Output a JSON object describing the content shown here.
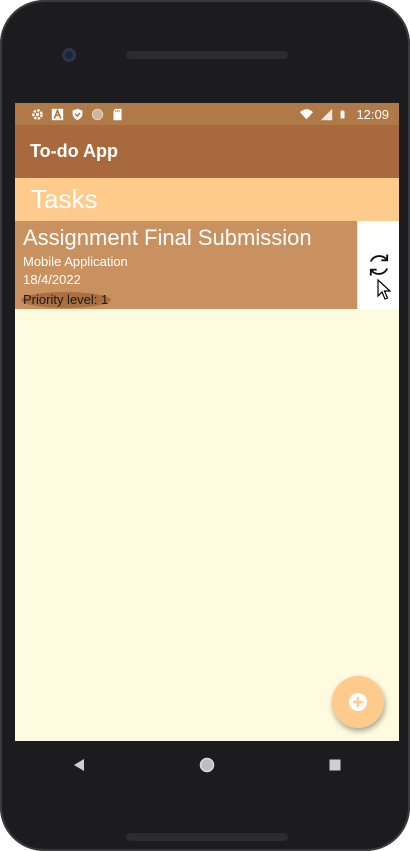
{
  "status_bar": {
    "time": "12:09",
    "left_icons": [
      "settings-icon",
      "a-icon",
      "shield-icon",
      "circle-icon",
      "sd-card-icon"
    ],
    "right_icons": [
      "wifi-icon",
      "signal-icon",
      "battery-icon"
    ]
  },
  "app_bar": {
    "title": "To-do App"
  },
  "tasks_header": {
    "title": "Tasks"
  },
  "tasks": [
    {
      "title": "Assignment Final Submission",
      "category": "Mobile Application",
      "date": "18/4/2022",
      "priority_label": "Priority level: 1",
      "action_icon": "refresh-icon"
    }
  ],
  "fab": {
    "icon": "add-circle-icon"
  },
  "nav_bar": {
    "buttons": [
      "back-icon",
      "home-icon",
      "recents-icon"
    ]
  },
  "colors": {
    "status_bar": "#b07a48",
    "app_bar": "#a8693c",
    "tasks_header": "#ffcb8c",
    "task_card": "#c8915f",
    "background": "#fffbe0",
    "fab": "#ffcb8c"
  }
}
